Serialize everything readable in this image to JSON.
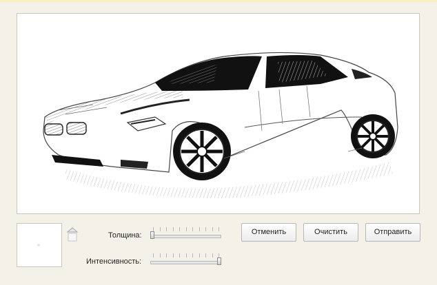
{
  "controls": {
    "thickness_label": "Толщина:",
    "thickness_value": 0.0,
    "intensity_label": "Интенсивность:",
    "intensity_value": 1.0
  },
  "buttons": {
    "cancel_label": "Отменить",
    "clear_label": "Очистить",
    "send_label": "Отправить"
  },
  "colors": {
    "background": "#f4f2e8",
    "canvas": "#ffffff",
    "border": "#c9c7bd"
  },
  "icons": {
    "color_arrow": "up-arrow-icon"
  }
}
